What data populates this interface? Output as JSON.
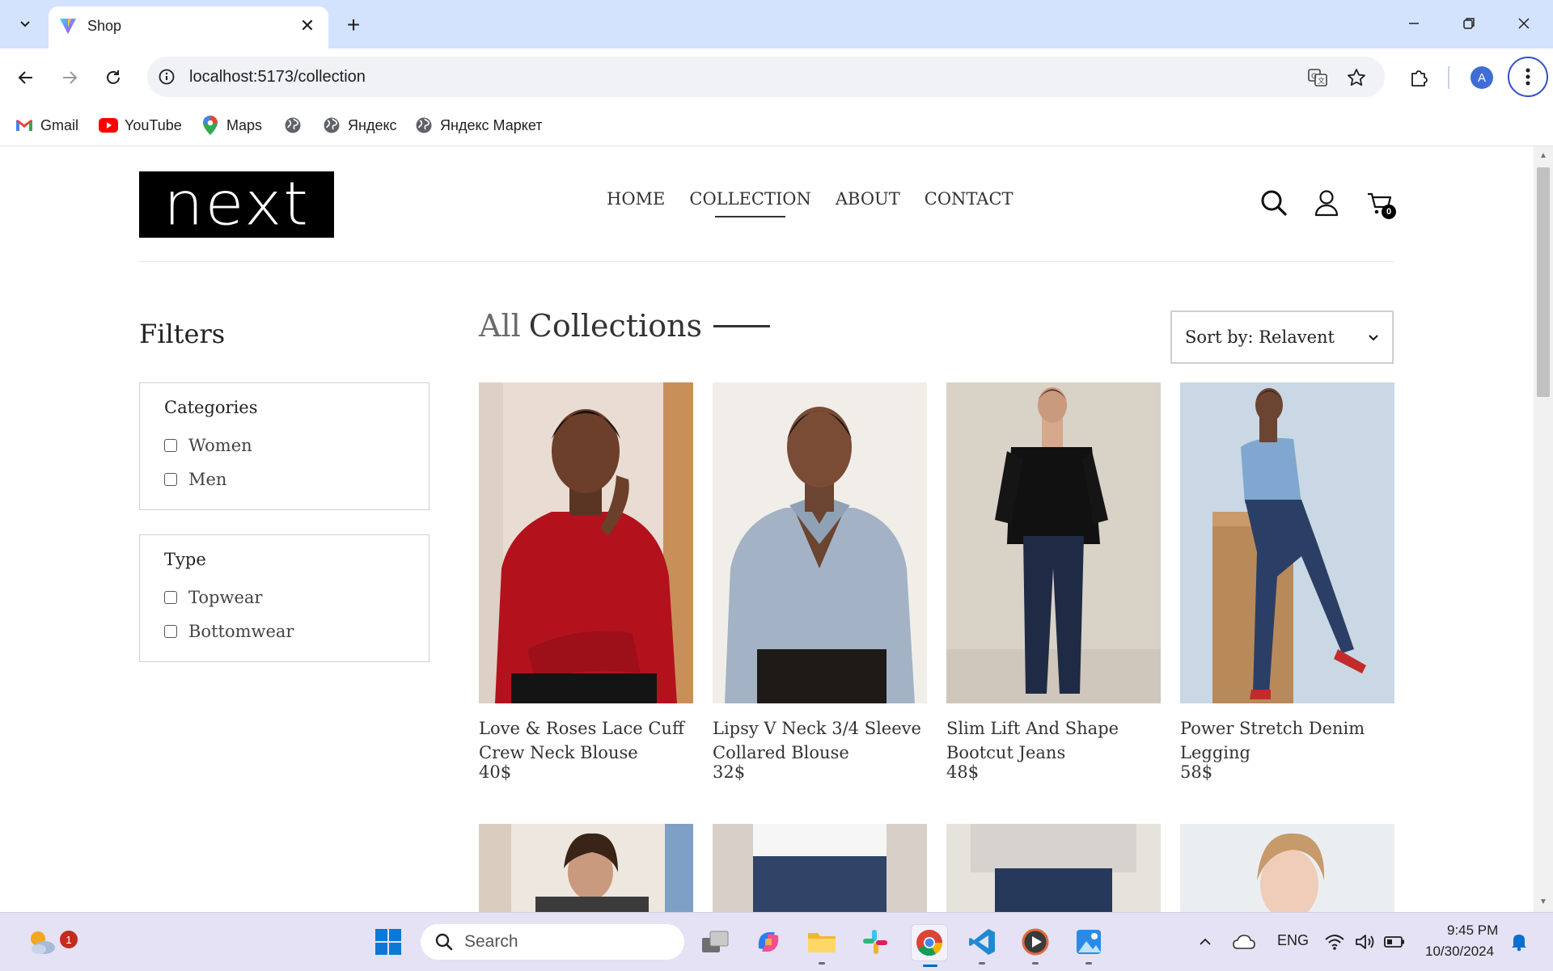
{
  "browser": {
    "tab_title": "Shop",
    "url": "localhost:5173/collection",
    "profile_initial": "A",
    "bookmarks": [
      {
        "label": "Gmail",
        "icon": "gmail-icon"
      },
      {
        "label": "YouTube",
        "icon": "youtube-icon"
      },
      {
        "label": "Maps",
        "icon": "maps-icon"
      },
      {
        "label": "",
        "icon": "globe-icon"
      },
      {
        "label": "Яндекс",
        "icon": "globe-icon"
      },
      {
        "label": "Яндекс Маркет",
        "icon": "globe-icon"
      }
    ]
  },
  "site": {
    "logo_text": "next",
    "nav": [
      "HOME",
      "COLLECTION",
      "ABOUT",
      "CONTACT"
    ],
    "active_nav": "COLLECTION",
    "cart_count": "0"
  },
  "filters": {
    "title": "Filters",
    "categories": {
      "title": "Categories",
      "options": [
        "Women",
        "Men"
      ]
    },
    "type": {
      "title": "Type",
      "options": [
        "Topwear",
        "Bottomwear"
      ]
    }
  },
  "collection": {
    "title_light": "All",
    "title_bold": "Collections",
    "sort_label": "Sort by: Relavent",
    "products": [
      {
        "name": "Love & Roses Lace Cuff Crew Neck Blouse",
        "price": "40$"
      },
      {
        "name": "Lipsy V Neck 3/4 Sleeve Collared Blouse",
        "price": "32$"
      },
      {
        "name": "Slim Lift And Shape Bootcut Jeans",
        "price": "48$"
      },
      {
        "name": "Power Stretch Denim Legging",
        "price": "58$"
      }
    ]
  },
  "taskbar": {
    "search_placeholder": "Search",
    "weather_badge": "1",
    "language": "ENG",
    "time": "9:45 PM",
    "date": "10/30/2024"
  },
  "colors": {
    "tabstrip": "#d3e3fd",
    "taskbar": "#e4e2f4",
    "logo_bg": "#000000"
  }
}
